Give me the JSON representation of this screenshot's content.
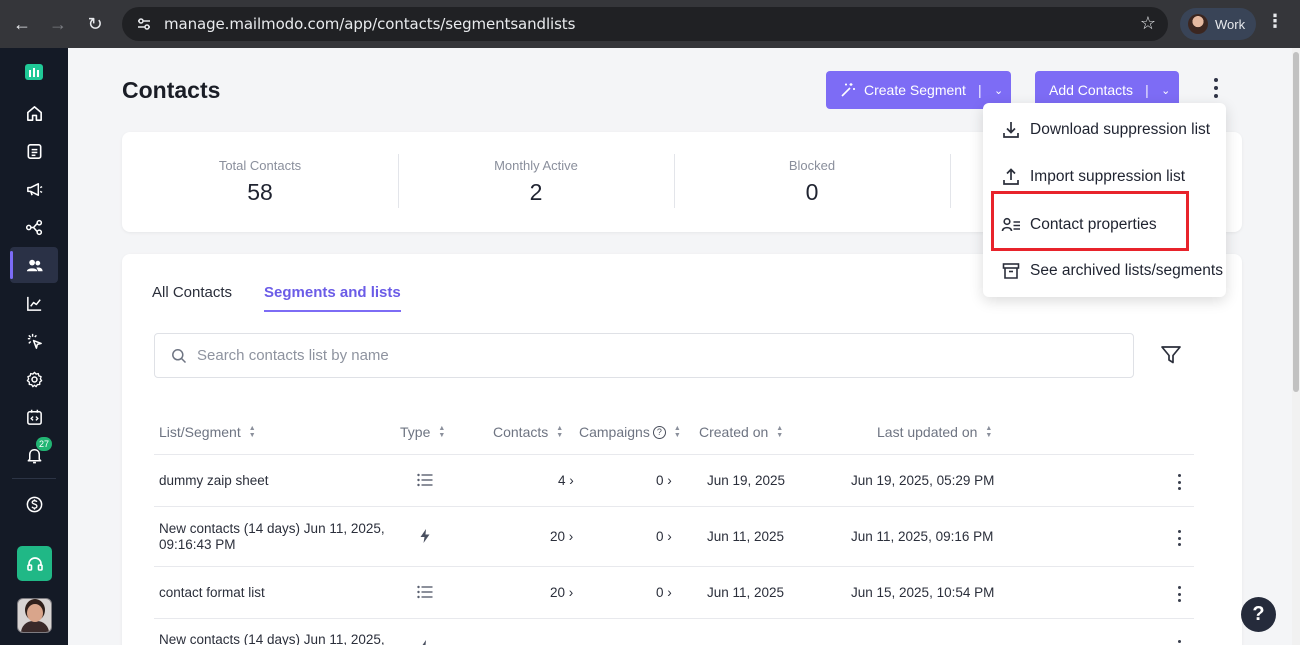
{
  "browser": {
    "url": "manage.mailmodo.com/app/contacts/segmentsandlists",
    "profile_label": "Work"
  },
  "sidebar": {
    "notification_count": "27",
    "items": [
      {
        "icon": "home-icon"
      },
      {
        "icon": "templates-icon"
      },
      {
        "icon": "campaigns-megaphone-icon"
      },
      {
        "icon": "journeys-icon"
      },
      {
        "icon": "contacts-icon",
        "active": true
      },
      {
        "icon": "analytics-icon"
      },
      {
        "icon": "events-click-icon"
      },
      {
        "icon": "settings-gear-icon"
      },
      {
        "icon": "developer-code-icon"
      },
      {
        "icon": "bell-icon"
      },
      {
        "icon": "billing-dollar-icon"
      }
    ]
  },
  "header": {
    "title": "Contacts",
    "create_segment_label": "Create Segment",
    "add_contacts_label": "Add Contacts"
  },
  "stats": [
    {
      "label": "Total Contacts",
      "value": "58"
    },
    {
      "label": "Monthly Active",
      "value": "2"
    },
    {
      "label": "Blocked",
      "value": "0"
    }
  ],
  "tabs": [
    {
      "label": "All Contacts"
    },
    {
      "label": "Segments and lists",
      "active": true
    }
  ],
  "search": {
    "placeholder": "Search contacts list by name"
  },
  "table": {
    "columns": [
      "List/Segment",
      "Type",
      "Contacts",
      "Campaigns",
      "Created on",
      "Last updated on"
    ],
    "rows": [
      {
        "name": "dummy zaip sheet",
        "type": "list",
        "contacts": "4",
        "campaigns": "0",
        "created": "Jun 19, 2025",
        "updated": "Jun 19, 2025, 05:29 PM"
      },
      {
        "name": "New contacts (14 days) Jun 11, 2025, 09:16:43 PM",
        "type": "segment",
        "contacts": "20",
        "campaigns": "0",
        "created": "Jun 11, 2025",
        "updated": "Jun 11, 2025, 09:16 PM"
      },
      {
        "name": "contact format list",
        "type": "list",
        "contacts": "20",
        "campaigns": "0",
        "created": "Jun 11, 2025",
        "updated": "Jun 15, 2025, 10:54 PM"
      },
      {
        "name": "New contacts (14 days) Jun 11, 2025,",
        "type": "segment",
        "contacts": "",
        "campaigns": "",
        "created": "",
        "updated": ""
      }
    ]
  },
  "dropdown": {
    "items": [
      {
        "label": "Download suppression list",
        "icon": "download-icon"
      },
      {
        "label": "Import suppression list",
        "icon": "upload-icon"
      },
      {
        "label": "Contact properties",
        "icon": "contact-properties-icon",
        "highlighted": true
      },
      {
        "label": "See archived lists/segments",
        "icon": "archive-icon"
      }
    ],
    "highlight_color": "#e8232b"
  },
  "colors": {
    "accent": "#7d6cf5",
    "sidebar_bg": "#141a26",
    "support": "#20b886"
  }
}
